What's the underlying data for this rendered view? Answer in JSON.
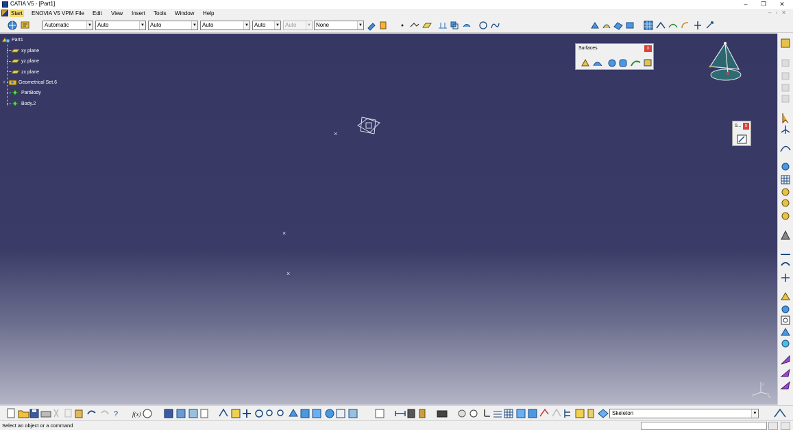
{
  "window": {
    "title": "CATIA V5 - [Part1]",
    "buttons": {
      "minimize": "–",
      "restore": "❐",
      "close": "✕"
    }
  },
  "menu": {
    "items": [
      "Start",
      "ENOVIA V5 VPM",
      "File",
      "Edit",
      "View",
      "Insert",
      "Tools",
      "Window",
      "Help"
    ],
    "active": "Start"
  },
  "toolbar_top": {
    "combos": [
      {
        "value": "Automatic",
        "disabled": false
      },
      {
        "value": "Auto",
        "disabled": false
      },
      {
        "value": "Auto",
        "disabled": false
      },
      {
        "value": "Auto",
        "disabled": false
      },
      {
        "value": "Auto",
        "disabled": false
      },
      {
        "value": "Auto",
        "disabled": true
      },
      {
        "value": "None",
        "disabled": false
      }
    ]
  },
  "tree": {
    "root": "Part1",
    "children": [
      "xy plane",
      "yz plane",
      "zx plane",
      "Geometrical Set.6",
      "PartBody",
      "Body.2"
    ]
  },
  "surfaces_toolbar": {
    "title": "Surfaces",
    "close": "x"
  },
  "small_toolbar": {
    "title": "S...",
    "close": "x"
  },
  "bottom_toolbar": {
    "render_style": "Skeleton"
  },
  "status": {
    "message": "Select an object or a command"
  },
  "colors": {
    "viewport_top": "#363763",
    "viewport_bottom": "#b4b5c5",
    "menu_highlight": "#f7dc6f",
    "close_red": "#d9443a"
  }
}
